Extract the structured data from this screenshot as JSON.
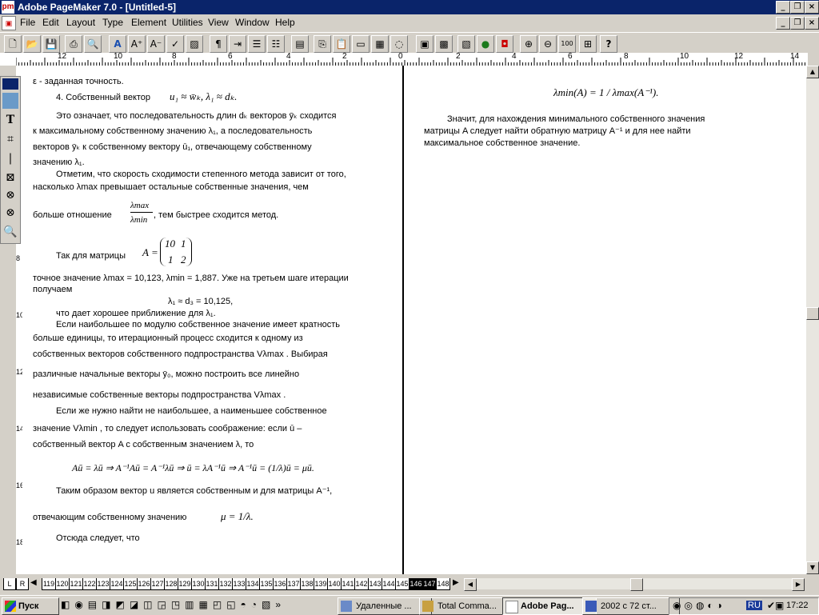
{
  "titlebar": {
    "title": "Adobe PageMaker 7.0 - [Untitled-5]",
    "app_icon": "pm"
  },
  "menu": {
    "items": [
      "File",
      "Edit",
      "Layout",
      "Type",
      "Element",
      "Utilities",
      "View",
      "Window",
      "Help"
    ]
  },
  "hruler": {
    "labels": [
      "12",
      "10",
      "8",
      "6",
      "4",
      "2",
      "0",
      "2",
      "4",
      "6",
      "8",
      "10",
      "12",
      "14"
    ]
  },
  "vruler": {
    "labels": [
      "8",
      "10",
      "12",
      "14",
      "16",
      "18"
    ]
  },
  "doc": {
    "l1": "ε - заданная точность.",
    "l2": "4. Собственный вектор",
    "l2m": "u₁ ≈ w̄ₖ,  λ₁ ≈ dₖ.",
    "p1a": "Это означает, что последовательность длин dₖ векторов ȳₖ сходится",
    "p1b": "к максимальному собственному значению λ₁, а последовательность",
    "p1c": "векторов ȳₖ к собственному вектору ū₁, отвечающему собственному",
    "p1d": "значению λ₁.",
    "p2a": "Отметим, что скорость сходимости степенного метода зависит от того,",
    "p2b": "насколько λmax превышает остальные собственные значения, чем",
    "p2c1": "больше отношение",
    "p2frac_top": "λmax",
    "p2frac_bot": "λmin",
    "p2c2": ", тем быстрее сходится метод.",
    "p3a": "Так для матрицы",
    "matrixA": "A =",
    "m11": "10",
    "m12": "1",
    "m21": "1",
    "m22": "2",
    "p4a": "точное значение λmax = 10,123, λmin = 1,887. Уже на третьем шаге итерации",
    "p4b": "получаем",
    "p4c": "λ₁ ≈ d₃ = 10,125,",
    "p4d": "что дает хорошее приближение для λ₁.",
    "p5a": "Если наибольшее по модулю собственное значение имеет кратность",
    "p5b": "больше единицы, то итерационный процесс сходится к одному из",
    "p5c": "собственных векторов собственного подпространства Vλmax . Выбирая",
    "p5d": "различные начальные векторы ȳ₀, можно построить все линейно",
    "p5e": "независимые собственные векторы подпространства Vλmax .",
    "p6a": "Если же нужно найти не наибольшее, а наименьшее собственное",
    "p6b": "значение Vλmin , то следует использовать соображение: если ū  –",
    "p6c": "собственный вектор A с собственным значением λ, то",
    "eq1": "Aū = λū ⇒ A⁻¹Aū = A⁻¹λū ⇒ ū = λA⁻¹ū ⇒ A⁻¹ū = (1/λ)ū = μū.",
    "p7a": "Таким образом вектор u является собственным и для матрицы A⁻¹,",
    "p7b": "отвечающим собственному значению",
    "p7m": "μ = 1/λ.",
    "p8": "Отсюда следует, что",
    "r_eq": "λmin(A) = 1 / λmax(A⁻¹).",
    "r1": "Значит, для нахождения минимального собственного значения",
    "r2": "матрицы A следует найти обратную матрицу A⁻¹ и для нее найти",
    "r3": "максимальное собственное значение."
  },
  "pagetabs": {
    "left": [
      "L",
      "R"
    ],
    "pages": [
      "119",
      "120",
      "121",
      "122",
      "123",
      "124",
      "125",
      "126",
      "127",
      "128",
      "129",
      "130",
      "131",
      "132",
      "133",
      "134",
      "135",
      "136",
      "137",
      "138",
      "139",
      "140",
      "141",
      "142",
      "143",
      "144",
      "145",
      "146",
      "147",
      "148"
    ],
    "selected": [
      "146",
      "147"
    ]
  },
  "taskbar": {
    "start": "Пуск",
    "tasks": [
      "Удаленные ...",
      "Total Comma...",
      "Adobe Pag...",
      "2002 с 72 ст..."
    ],
    "active_task": "Adobe Pag...",
    "lang": "RU",
    "clock": "17:22"
  },
  "colors": {
    "titlebar": "#0a246a",
    "chrome": "#d4d0c8",
    "page": "#ffffff"
  }
}
